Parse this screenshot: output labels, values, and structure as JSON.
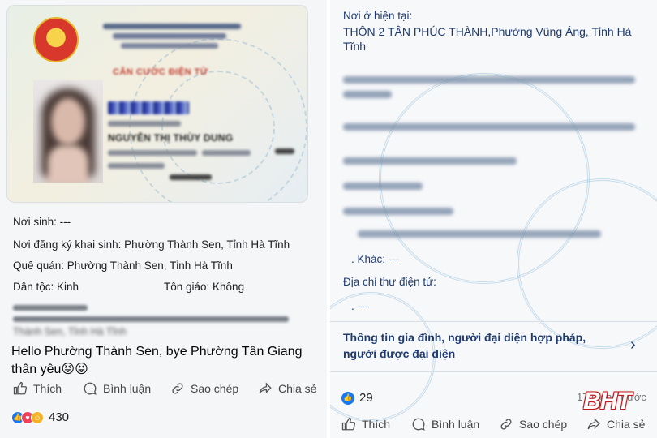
{
  "left_post": {
    "card": {
      "title": "CĂN CƯỚC ĐIỆN TỬ",
      "name": "NGUYỄN THỊ THÙY DUNG"
    },
    "info": {
      "birthplace": "Nơi sinh: ---",
      "birth_registration": "Nơi đăng ký khai sinh: Phường Thành Sen, Tỉnh Hà Tĩnh",
      "hometown": "Quê quán: Phường Thành Sen, Tỉnh Hà Tĩnh",
      "ethnicity": "Dân tộc: Kinh",
      "religion": "Tôn giáo: Không",
      "residence_tail": "Thành Sen, Tỉnh Hà Tĩnh"
    },
    "post_text": "Hello Phường Thành Sen, bye Phường Tân Giang thân yêu😝😝",
    "actions": {
      "like": "Thích",
      "comment": "Bình luận",
      "copy": "Sao chép",
      "share": "Chia sẻ"
    },
    "reaction_count": "430"
  },
  "right_post": {
    "current_residence_label": "Nơi ở hiện tại:",
    "current_residence_value": "THÔN 2 TÂN PHÚC THÀNH,Phường Vũng Áng, Tỉnh Hà Tĩnh",
    "other_label": ". Khác: ---",
    "email_label": "Địa chỉ thư điện tử:",
    "email_value": ". ---",
    "family_link": "Thông tin gia đình, người đại diện hợp pháp, người được đại diện",
    "reaction_count": "29",
    "time": "17 tháng trước",
    "actions": {
      "like": "Thích",
      "comment": "Bình luận",
      "copy": "Sao chép",
      "share": "Chia sẻ"
    },
    "watermark": "BHT"
  },
  "colors": {
    "link_blue": "#1e3a6e",
    "fb_blue": "#1877f2",
    "watermark_red": "#c01818"
  }
}
